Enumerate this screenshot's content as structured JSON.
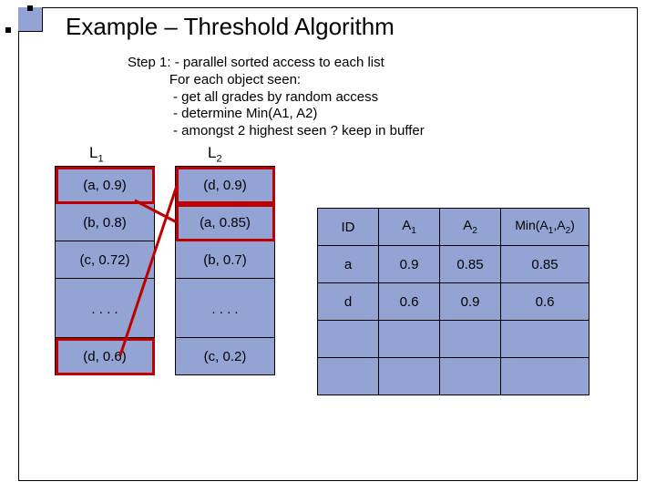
{
  "title": "Example – Threshold Algorithm",
  "step": {
    "heading": "Step 1: - parallel sorted access to each list",
    "l1": "For each object seen:",
    "l2": "- get all grades by random access",
    "l3": "- determine Min(A1, A2)",
    "l4": "- amongst 2 highest seen ? keep in buffer"
  },
  "labels": {
    "L1": "L",
    "L1sub": "1",
    "L2": "L",
    "L2sub": "2"
  },
  "list1": [
    "(a, 0.9)",
    "(b, 0.8)",
    "(c, 0.72)",
    "",
    "(d, 0.6)"
  ],
  "list2": [
    "(d, 0.9)",
    "(a, 0.85)",
    "(b, 0.7)",
    "",
    "(c, 0.2)"
  ],
  "dots": ".\n.\n.\n.",
  "result": {
    "head": [
      "ID",
      "A",
      "A",
      "Min(A",
      "A",
      ")"
    ],
    "sub1": "1",
    "sub2": "2",
    "rows": [
      {
        "id": "a",
        "a1": "0.9",
        "a2": "0.85",
        "min": "0.85"
      },
      {
        "id": "d",
        "a1": "0.6",
        "a2": "0.9",
        "min": "0.6"
      },
      {
        "id": "",
        "a1": "",
        "a2": "",
        "min": ""
      },
      {
        "id": "",
        "a1": "",
        "a2": "",
        "min": ""
      }
    ]
  }
}
